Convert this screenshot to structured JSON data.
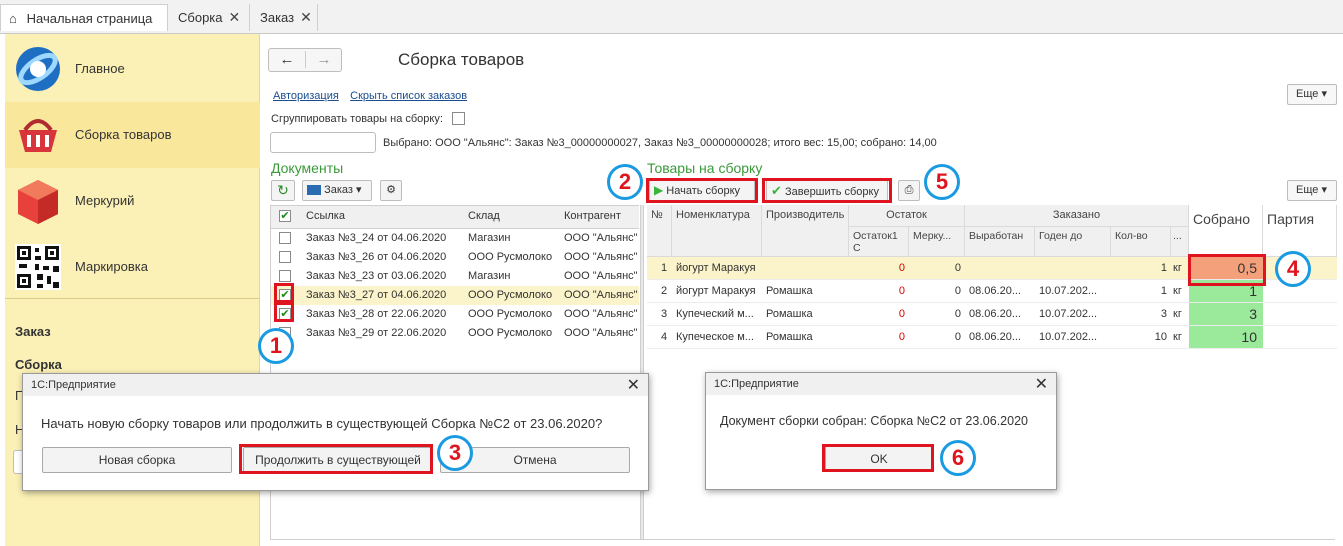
{
  "tabs": [
    {
      "label": "Начальная страница"
    },
    {
      "label": "Сборка"
    },
    {
      "label": "Заказ"
    }
  ],
  "sidebar": {
    "items": [
      {
        "label": "Главное"
      },
      {
        "label": "Сборка товаров"
      },
      {
        "label": "Меркурий"
      },
      {
        "label": "Маркировка"
      }
    ],
    "sub": [
      {
        "label": "Заказ"
      },
      {
        "label": "Сборка"
      },
      {
        "label": "П"
      },
      {
        "label": "Н"
      }
    ]
  },
  "header": {
    "back": "←",
    "forward": "→",
    "title": "Сборка товаров",
    "link_auth": "Авторизация",
    "link_hide": "Скрыть список  заказов",
    "more": "Еще",
    "group_label": "Сгруппировать товары на сборку:",
    "selected_info": "Выбрано:  ООО \"Альянс\": Заказ №3_00000000027, Заказ №3_00000000028; итого вес: 15,00; собрано: 14,00"
  },
  "documents": {
    "title": "Документы",
    "order_btn": "Заказ",
    "columns": [
      "Ссылка",
      "Склад",
      "Контрагент"
    ],
    "rows": [
      {
        "ref": "Заказ №3_24 от 04.06.2020",
        "stock": "Магазин",
        "agent": "ООО \"Альянс\"",
        "checked": ""
      },
      {
        "ref": "Заказ №3_26 от 04.06.2020",
        "stock": "ООО Русмолоко",
        "agent": "ООО \"Альянс\"",
        "checked": ""
      },
      {
        "ref": "Заказ №3_23 от 03.06.2020",
        "stock": "Магазин",
        "agent": "ООО \"Альянс\"",
        "checked": ""
      },
      {
        "ref": "Заказ №3_27 от 04.06.2020",
        "stock": "ООО Русмолоко",
        "agent": "ООО \"Альянс\"",
        "checked": "✔"
      },
      {
        "ref": "Заказ №3_28 от 22.06.2020",
        "stock": "ООО Русмолоко",
        "agent": "ООО \"Альянс\"",
        "checked": "✔"
      },
      {
        "ref": "Заказ №3_29 от 22.06.2020",
        "stock": "ООО Русмолоко",
        "agent": "ООО \"Альянс\"",
        "checked": ""
      }
    ]
  },
  "goods": {
    "title": "Товары на сборку",
    "start_btn": "Начать  сборку",
    "finish_btn": "Завершить  сборку",
    "more": "Еще",
    "headers": {
      "num": "№",
      "nomen": "Номенклатура",
      "maker": "Производитель",
      "rest": "Остаток",
      "rest1": "Остаток1 С",
      "merk": "Мерку...",
      "ordered": "Заказано",
      "made": "Выработан",
      "until": "Годен до",
      "qty": "Кол-во",
      "unit": "...",
      "got": "Собрано",
      "batch": "Партия"
    },
    "rows": [
      {
        "n": "1",
        "name": "йогурт Маракуя",
        "maker": "",
        "rest1": "0",
        "merk": "0",
        "made": "",
        "until": "",
        "qty": "1",
        "unit": "кг",
        "got": "0,5"
      },
      {
        "n": "2",
        "name": "йогурт Маракуя",
        "maker": "Ромашка",
        "rest1": "0",
        "merk": "0",
        "made": "08.06.20...",
        "until": "10.07.202...",
        "qty": "1",
        "unit": "кг",
        "got": "1"
      },
      {
        "n": "3",
        "name": "Купеческий м...",
        "maker": "Ромашка",
        "rest1": "0",
        "merk": "0",
        "made": "08.06.20...",
        "until": "10.07.202...",
        "qty": "3",
        "unit": "кг",
        "got": "3"
      },
      {
        "n": "4",
        "name": "Купеческое м...",
        "maker": "Ромашка",
        "rest1": "0",
        "merk": "0",
        "made": "08.06.20...",
        "until": "10.07.202...",
        "qty": "10",
        "unit": "кг",
        "got": "10"
      }
    ]
  },
  "dialog1": {
    "title": "1С:Предприятие",
    "message": "Начать новую сборку товаров или продолжить в существующей Сборка №С2 от 23.06.2020?",
    "btn_new": "Новая сборка",
    "btn_continue": "Продолжить в существующей",
    "btn_cancel": "Отмена"
  },
  "dialog2": {
    "title": "1С:Предприятие",
    "message": "Документ сборки собран: Сборка №С2 от 23.06.2020",
    "btn_ok": "OK"
  },
  "markers": [
    "1",
    "2",
    "3",
    "4",
    "5",
    "6"
  ],
  "colors": {
    "accent_red": "#e0141e",
    "marker_blue": "#1a9ae0",
    "collected_green": "#9be99b",
    "collected_partial": "#f4a07a",
    "sidebar_bg": "#fbf0b6"
  }
}
